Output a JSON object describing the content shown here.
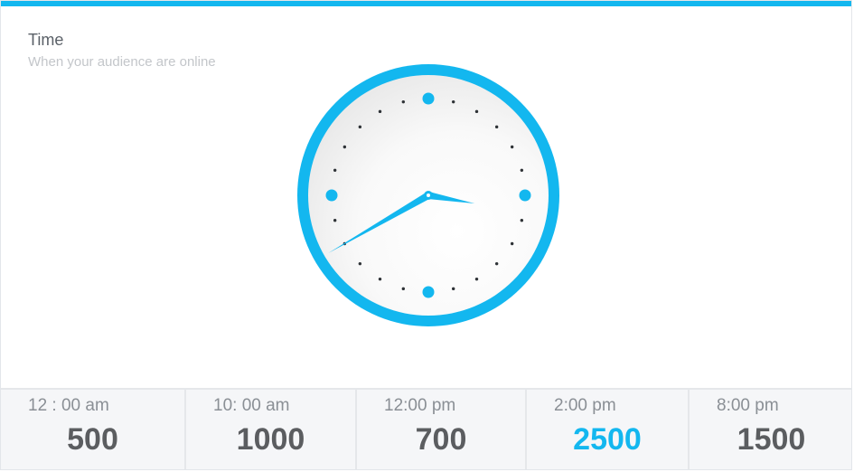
{
  "widget": {
    "title": "Time",
    "subtitle": "When your audience are online"
  },
  "clock": {
    "hour_hand_angle_deg": 100,
    "minute_hand_angle_deg": 240,
    "accent_color": "#13b7ef"
  },
  "time_slots": [
    {
      "time": "12 : 00 am",
      "count": "500",
      "highlighted": false
    },
    {
      "time": "10: 00 am",
      "count": "1000",
      "highlighted": false
    },
    {
      "time": "12:00 pm",
      "count": "700",
      "highlighted": false
    },
    {
      "time": "2:00 pm",
      "count": "2500",
      "highlighted": true
    },
    {
      "time": "8:00 pm",
      "count": "1500",
      "highlighted": false
    }
  ],
  "colors": {
    "accent": "#13b7ef",
    "count_text": "#5b5d60",
    "time_text": "#8a8f95"
  }
}
